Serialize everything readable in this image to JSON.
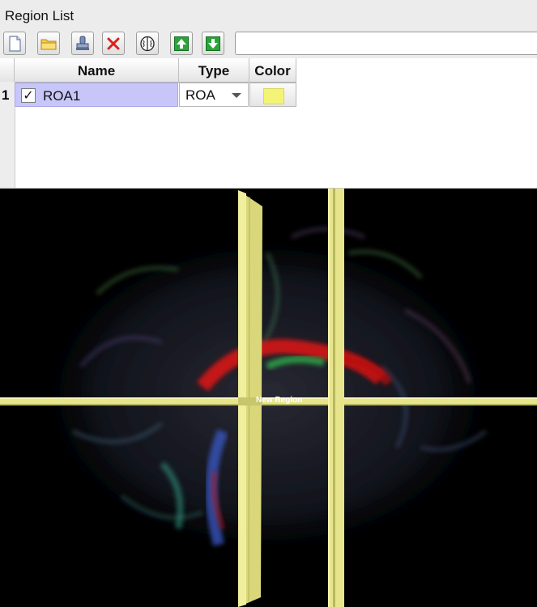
{
  "panel": {
    "title": "Region List"
  },
  "toolbar": {
    "buttons": [
      {
        "name": "new-document-icon"
      },
      {
        "name": "open-folder-icon"
      },
      {
        "name": "save-stamp-icon"
      },
      {
        "name": "delete-x-icon"
      },
      {
        "name": "brain-icon"
      },
      {
        "name": "move-up-icon"
      },
      {
        "name": "move-down-icon"
      }
    ],
    "filter_value": "",
    "accent_green": "#2aa33a",
    "delete_red": "#d9231c"
  },
  "table": {
    "headers": {
      "name": "Name",
      "type": "Type",
      "color": "Color"
    },
    "rows": [
      {
        "index": "1",
        "checked": "✓",
        "name": "ROA1",
        "type": "ROA",
        "color": "#f3f376"
      }
    ]
  },
  "viewport": {
    "label": "New Region",
    "plane_color": "#e7e58c"
  }
}
